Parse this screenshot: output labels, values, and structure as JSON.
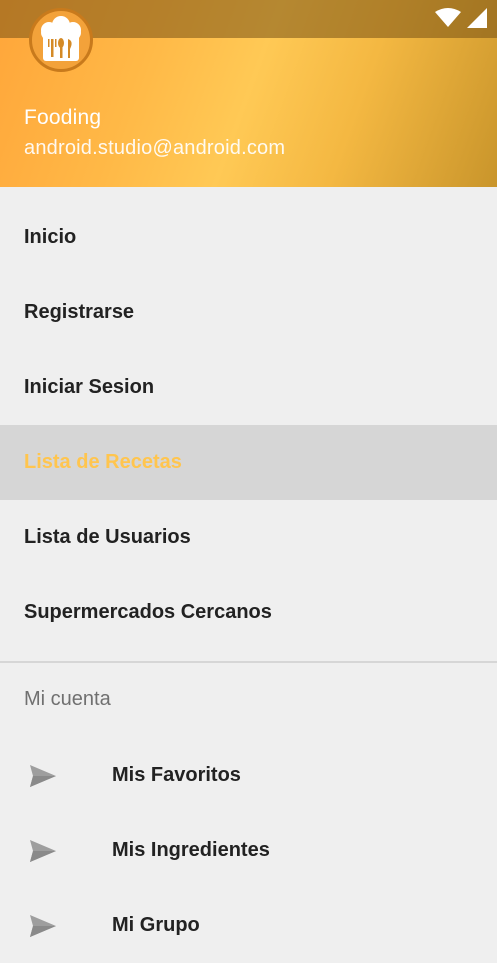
{
  "header": {
    "app_name": "Fooding",
    "email": "android.studio@android.com",
    "logo": "chef-hat-cutlery-logo"
  },
  "status_bar": {
    "icons": [
      "wifi-icon",
      "cellular-signal-icon"
    ]
  },
  "menu": {
    "items": [
      {
        "label": "Inicio",
        "active": false
      },
      {
        "label": "Registrarse",
        "active": false
      },
      {
        "label": "Iniciar Sesion",
        "active": false
      },
      {
        "label": "Lista de Recetas",
        "active": true
      },
      {
        "label": "Lista de Usuarios",
        "active": false
      },
      {
        "label": "Supermercados Cercanos",
        "active": false
      }
    ]
  },
  "account": {
    "title": "Mi cuenta",
    "items": [
      {
        "label": "Mis Favoritos",
        "icon": "send-arrow-icon"
      },
      {
        "label": "Mis Ingredientes",
        "icon": "send-arrow-icon"
      },
      {
        "label": "Mi Grupo",
        "icon": "send-arrow-icon"
      }
    ]
  },
  "colors": {
    "accent": "#ffc54e",
    "header_gradient_start": "#ffa63a",
    "header_gradient_end": "#c9952b",
    "active_background": "#d6d6d6"
  }
}
